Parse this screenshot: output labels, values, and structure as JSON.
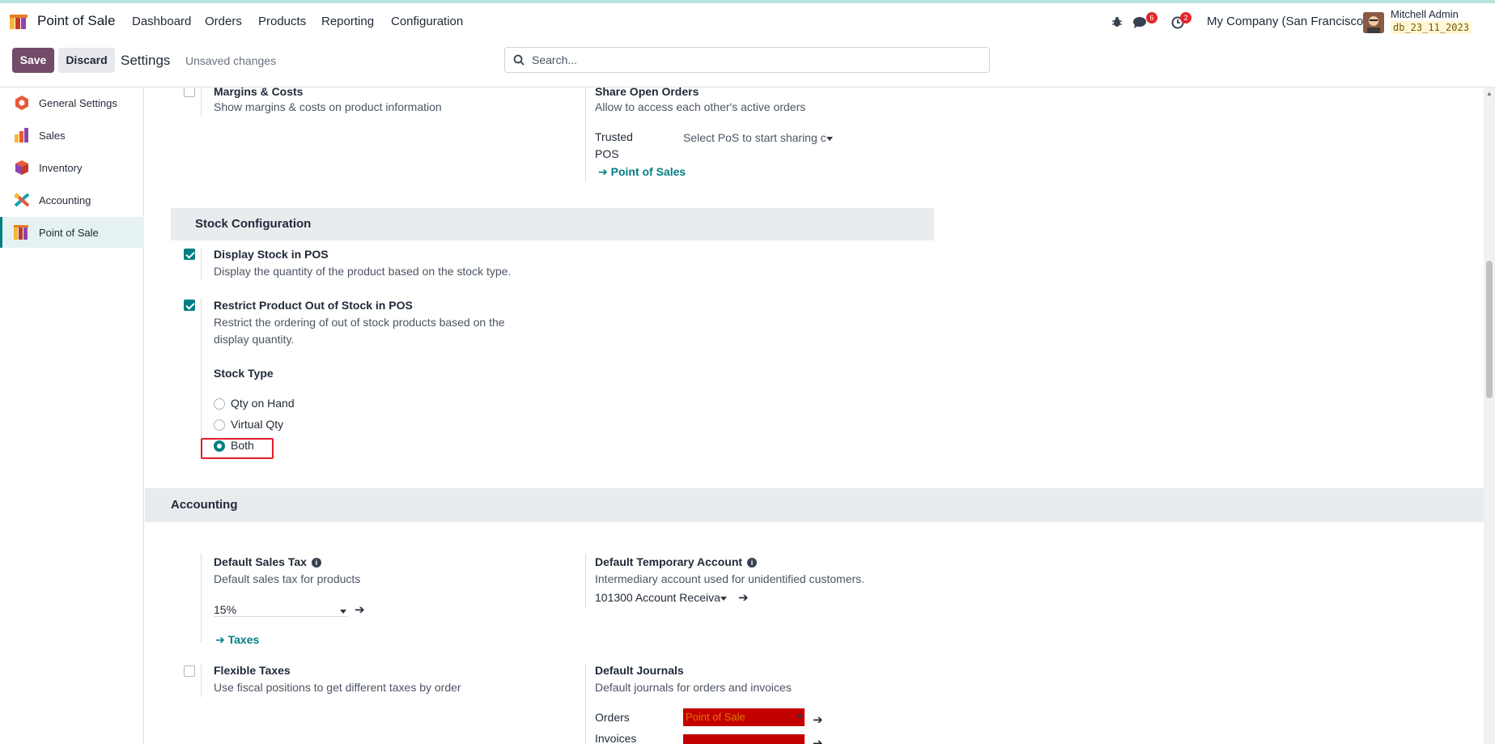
{
  "navbar": {
    "app_name": "Point of Sale",
    "menus": [
      "Dashboard",
      "Orders",
      "Products",
      "Reporting",
      "Configuration"
    ],
    "messages_count": "6",
    "activities_count": "2",
    "company": "My Company (San Francisco)",
    "user_name": "Mitchell Admin",
    "db_name": "db_23_11_2023"
  },
  "control_panel": {
    "save_label": "Save",
    "discard_label": "Discard",
    "breadcrumb": "Settings",
    "unsaved": "Unsaved changes",
    "search_placeholder": "Search..."
  },
  "sidebar": {
    "items": [
      {
        "label": "General Settings",
        "icon": "general-settings-icon"
      },
      {
        "label": "Sales",
        "icon": "sales-icon"
      },
      {
        "label": "Inventory",
        "icon": "inventory-icon"
      },
      {
        "label": "Accounting",
        "icon": "accounting-icon"
      },
      {
        "label": "Point of Sale",
        "icon": "point-of-sale-icon",
        "active": true
      }
    ]
  },
  "settings": {
    "margins": {
      "title": "Margins & Costs",
      "desc": "Show margins & costs on product information",
      "checked": false
    },
    "share_orders": {
      "title": "Share Open Orders",
      "desc": "Allow to access each other's active orders",
      "field_label_1": "Trusted",
      "field_label_2": "POS",
      "placeholder": "Select PoS to start sharing c",
      "link": "Point of Sales"
    },
    "stock_section": "Stock Configuration",
    "display_stock": {
      "title": "Display Stock in POS",
      "desc": "Display the quantity of the product based on the stock type.",
      "checked": true
    },
    "restrict_stock": {
      "title": "Restrict Product Out of Stock in POS",
      "desc_1": "Restrict the ordering of out of stock products based on the",
      "desc_2": "display quantity.",
      "checked": true
    },
    "stock_type": {
      "label": "Stock Type",
      "options": [
        "Qty on Hand",
        "Virtual Qty",
        "Both"
      ],
      "selected": "Both"
    },
    "accounting_section": "Accounting",
    "default_sales_tax": {
      "title": "Default Sales Tax",
      "desc": "Default sales tax for products",
      "value": "15%",
      "link": "Taxes"
    },
    "default_temp_account": {
      "title": "Default Temporary Account",
      "desc": "Intermediary account used for unidentified customers.",
      "value": "101300 Account Receiva"
    },
    "flexible_taxes": {
      "title": "Flexible Taxes",
      "desc": "Use fiscal positions to get different taxes by order",
      "checked": false
    },
    "default_journals": {
      "title": "Default Journals",
      "desc": "Default journals for orders and invoices",
      "orders_label": "Orders",
      "orders_value": "Point of Sale",
      "invoices_label": "Invoices"
    }
  },
  "colors": {
    "brand": "#714b67",
    "accent": "#017e84",
    "highlight": "#e21d2b"
  }
}
